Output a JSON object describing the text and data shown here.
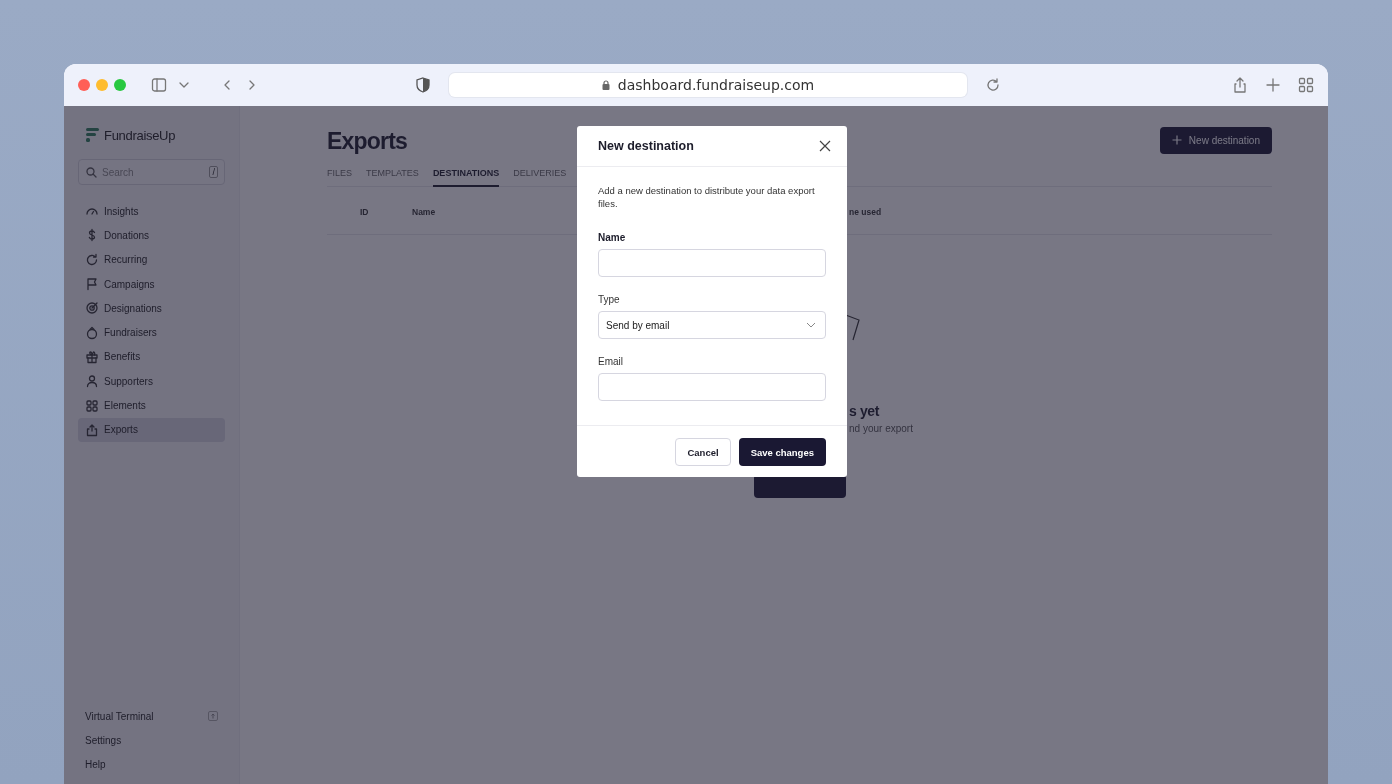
{
  "browser": {
    "url": "dashboard.fundraiseup.com"
  },
  "sidebar": {
    "brand": "FundraiseUp",
    "search": {
      "placeholder": "Search",
      "shortcut": "/"
    },
    "items": [
      {
        "label": "Insights",
        "selected": false
      },
      {
        "label": "Donations",
        "selected": false
      },
      {
        "label": "Recurring",
        "selected": false
      },
      {
        "label": "Campaigns",
        "selected": false
      },
      {
        "label": "Designations",
        "selected": false
      },
      {
        "label": "Fundraisers",
        "selected": false
      },
      {
        "label": "Benefits",
        "selected": false
      },
      {
        "label": "Supporters",
        "selected": false
      },
      {
        "label": "Elements",
        "selected": false
      },
      {
        "label": "Exports",
        "selected": true
      }
    ],
    "footer_items": [
      {
        "label": "Virtual Terminal",
        "external": true
      },
      {
        "label": "Settings",
        "external": false
      },
      {
        "label": "Help",
        "external": false
      }
    ]
  },
  "page": {
    "title": "Exports",
    "new_button": "New destination",
    "tabs": [
      {
        "label": "FILES",
        "selected": false
      },
      {
        "label": "TEMPLATES",
        "selected": false
      },
      {
        "label": "DESTINATIONS",
        "selected": true
      },
      {
        "label": "DELIVERIES",
        "selected": false
      }
    ],
    "table": {
      "columns": [
        "ID",
        "Name",
        "ne used"
      ]
    },
    "empty_state": {
      "title": "s yet",
      "subtitle": "nd your export"
    }
  },
  "modal": {
    "title": "New destination",
    "description": "Add a new destination to distribute your data export files.",
    "fields": [
      {
        "label": "Name",
        "kind": "text",
        "strong": true
      },
      {
        "label": "Type",
        "kind": "select",
        "value": "Send by email",
        "strong": false
      },
      {
        "label": "Email",
        "kind": "text",
        "strong": false
      }
    ],
    "buttons": [
      {
        "label": "Cancel",
        "kind": "secondary"
      },
      {
        "label": "Save changes",
        "kind": "primary"
      }
    ]
  }
}
